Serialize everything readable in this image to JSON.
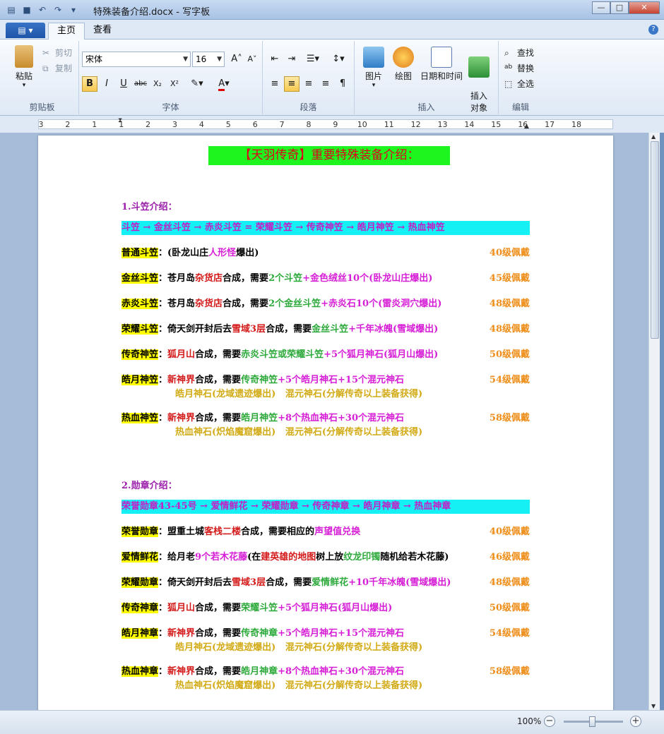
{
  "window": {
    "title": "特殊装备介绍.docx - 写字板",
    "minimize": "—",
    "maximize": "□",
    "close": "✕"
  },
  "ribbon": {
    "file_menu": "▤ ▾",
    "tabs": [
      "主页",
      "查看"
    ],
    "help": "?",
    "clipboard": {
      "label": "剪贴板",
      "paste": "粘贴",
      "cut": "剪切",
      "copy": "复制"
    },
    "font": {
      "label": "字体",
      "family": "宋体",
      "size": "16"
    },
    "paragraph": {
      "label": "段落"
    },
    "insert": {
      "label": "插入",
      "picture": "图片",
      "paint": "绘图",
      "datetime": "日期和时间",
      "object": "插入\n对象"
    },
    "edit": {
      "label": "编辑",
      "find": "查找",
      "replace": "替换",
      "select_all": "全选"
    }
  },
  "ruler": {
    "labels": [
      "3",
      "2",
      "1",
      "1",
      "2",
      "3",
      "4",
      "5",
      "6",
      "7",
      "8",
      "9",
      "10",
      "11",
      "12",
      "13",
      "14",
      "15",
      "16",
      "17",
      "18"
    ]
  },
  "document": {
    "title": "【天羽传奇】重要特殊装备介绍：",
    "section1": {
      "heading": "1.斗笠介绍：",
      "chain": "斗笠 → 金丝斗笠 → 赤炎斗笠 = 荣耀斗笠 → 传奇神笠 → 皓月神笠 → 热血神笠",
      "rows": [
        {
          "label": "普通斗笠",
          "parts": [
            {
              "t": "：(卧龙山庄",
              "c": "c-black"
            },
            {
              "t": "人形怪",
              "c": "c-pink"
            },
            {
              "t": "爆出)",
              "c": "c-black"
            }
          ],
          "level": "40级佩戴"
        },
        {
          "label": "金丝斗笠",
          "parts": [
            {
              "t": "：苍月岛",
              "c": "c-black"
            },
            {
              "t": "杂货店",
              "c": "c-red"
            },
            {
              "t": "合成，需要",
              "c": "c-black"
            },
            {
              "t": "2个斗笠",
              "c": "c-green"
            },
            {
              "t": "+金色绒丝10个(卧龙山庄爆出)",
              "c": "c-pink"
            }
          ],
          "level": "45级佩戴"
        },
        {
          "label": "赤炎斗笠",
          "parts": [
            {
              "t": "：苍月岛",
              "c": "c-black"
            },
            {
              "t": "杂货店",
              "c": "c-red"
            },
            {
              "t": "合成，需要",
              "c": "c-black"
            },
            {
              "t": "2个金丝斗笠",
              "c": "c-green"
            },
            {
              "t": "+赤炎石10个(雷炎洞穴爆出)",
              "c": "c-pink"
            }
          ],
          "level": "48级佩戴"
        },
        {
          "label": "荣耀斗笠",
          "parts": [
            {
              "t": "：倚天剑开封后去",
              "c": "c-black"
            },
            {
              "t": "雪域3层",
              "c": "c-red"
            },
            {
              "t": "合成，需要",
              "c": "c-black"
            },
            {
              "t": "金丝斗笠",
              "c": "c-green"
            },
            {
              "t": "+千年冰魄(雪域爆出)",
              "c": "c-pink"
            }
          ],
          "level": "48级佩戴"
        },
        {
          "label": "传奇神笠",
          "parts": [
            {
              "t": "：",
              "c": "c-black"
            },
            {
              "t": "狐月山",
              "c": "c-red"
            },
            {
              "t": "合成，需要",
              "c": "c-black"
            },
            {
              "t": "赤炎斗笠或荣耀斗笠",
              "c": "c-green"
            },
            {
              "t": "+5个狐月神石(狐月山爆出)",
              "c": "c-pink"
            }
          ],
          "level": "50级佩戴"
        },
        {
          "label": "皓月神笠",
          "parts": [
            {
              "t": "：",
              "c": "c-black"
            },
            {
              "t": "新神界",
              "c": "c-red"
            },
            {
              "t": "合成，需要",
              "c": "c-black"
            },
            {
              "t": "传奇神笠",
              "c": "c-green"
            },
            {
              "t": "+5个皓月神石+15个混元神石",
              "c": "c-pink"
            }
          ],
          "level": "54级佩戴",
          "sub": "皓月神石(龙域遗迹爆出)   混元神石(分解传奇以上装备获得)"
        },
        {
          "label": "热血神笠",
          "parts": [
            {
              "t": "：",
              "c": "c-black"
            },
            {
              "t": "新神界",
              "c": "c-red"
            },
            {
              "t": "合成，需要",
              "c": "c-black"
            },
            {
              "t": "皓月神笠",
              "c": "c-green"
            },
            {
              "t": "+8个热血神石+30个混元神石",
              "c": "c-pink"
            }
          ],
          "level": "58级佩戴",
          "sub": "热血神石(炽焰魔窟爆出)   混元神石(分解传奇以上装备获得)"
        }
      ]
    },
    "section2": {
      "heading": "2.勋章介绍：",
      "chain": "荣誉勋章43-45号 → 爱情鲜花 → 荣耀勋章 → 传奇神章 → 皓月神章 → 热血神章",
      "rows": [
        {
          "label": "荣誉勋章",
          "parts": [
            {
              "t": "：盟重土城",
              "c": "c-black"
            },
            {
              "t": "客栈二楼",
              "c": "c-red"
            },
            {
              "t": "合成，需要相应的",
              "c": "c-black"
            },
            {
              "t": "声望值兑换",
              "c": "c-pink"
            }
          ],
          "level": "40级佩戴"
        },
        {
          "label": "爱情鲜花",
          "parts": [
            {
              "t": "：给月老",
              "c": "c-black"
            },
            {
              "t": "9个若木花藤",
              "c": "c-pink"
            },
            {
              "t": "(在",
              "c": "c-black"
            },
            {
              "t": "建英雄的地图",
              "c": "c-red"
            },
            {
              "t": "树上放",
              "c": "c-black"
            },
            {
              "t": "纹龙印镯",
              "c": "c-green"
            },
            {
              "t": "随机给若木花藤)",
              "c": "c-black"
            }
          ],
          "level": "46级佩戴"
        },
        {
          "label": "荣耀勋章",
          "parts": [
            {
              "t": "：倚天剑开封后去",
              "c": "c-black"
            },
            {
              "t": "雪域3层",
              "c": "c-red"
            },
            {
              "t": "合成，需要",
              "c": "c-black"
            },
            {
              "t": "爱情鲜花",
              "c": "c-green"
            },
            {
              "t": "+10千年冰魄(雪域爆出)",
              "c": "c-pink"
            }
          ],
          "level": "48级佩戴"
        },
        {
          "label": "传奇神章",
          "parts": [
            {
              "t": "：",
              "c": "c-black"
            },
            {
              "t": "狐月山",
              "c": "c-red"
            },
            {
              "t": "合成，需要",
              "c": "c-black"
            },
            {
              "t": "荣耀斗笠",
              "c": "c-green"
            },
            {
              "t": "+5个狐月神石(狐月山爆出)",
              "c": "c-pink"
            }
          ],
          "level": "50级佩戴"
        },
        {
          "label": "皓月神章",
          "parts": [
            {
              "t": "：",
              "c": "c-black"
            },
            {
              "t": "新神界",
              "c": "c-red"
            },
            {
              "t": "合成，需要",
              "c": "c-black"
            },
            {
              "t": "传奇神章",
              "c": "c-green"
            },
            {
              "t": "+5个皓月神石+15个混元神石",
              "c": "c-pink"
            }
          ],
          "level": "54级佩戴",
          "sub": "皓月神石(龙域遗迹爆出)   混元神石(分解传奇以上装备获得)"
        },
        {
          "label": "热血神章",
          "parts": [
            {
              "t": "：",
              "c": "c-black"
            },
            {
              "t": "新神界",
              "c": "c-red"
            },
            {
              "t": "合成，需要",
              "c": "c-black"
            },
            {
              "t": "皓月神章",
              "c": "c-green"
            },
            {
              "t": "+8个热血神石+30个混元神石",
              "c": "c-pink"
            }
          ],
          "level": "58级佩戴",
          "sub": "热血神石(炽焰魔窟爆出)   混元神石(分解传奇以上装备获得)"
        }
      ]
    }
  },
  "status": {
    "zoom": "100%",
    "zoom_out": "−",
    "zoom_in": "+"
  },
  "colors": {
    "title_bg": "#1ef51e",
    "chain_bg": "#14f0f4",
    "label_bg": "#ffff00",
    "level": "#ee8d18"
  }
}
